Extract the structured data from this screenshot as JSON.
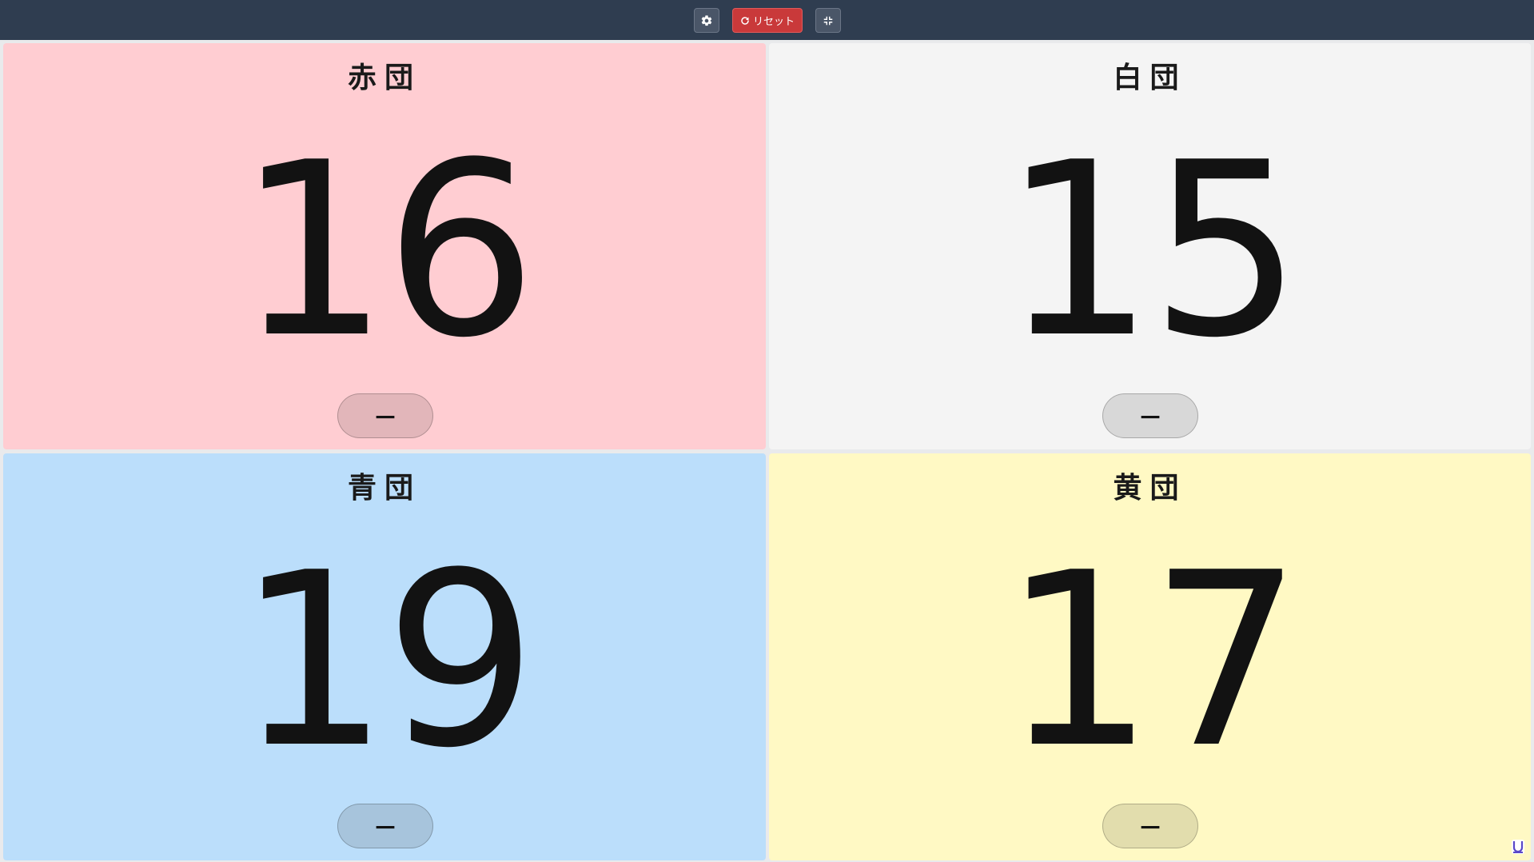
{
  "toolbar": {
    "settings_icon": "gear-icon",
    "reset_label": "リセット",
    "reset_icon": "refresh-icon",
    "fullscreen_icon": "exit-fullscreen-icon"
  },
  "teams": [
    {
      "name": "赤団",
      "score": "16",
      "minus_label": "－",
      "color": "#ffcdd2",
      "button_color": "#e2b6ba"
    },
    {
      "name": "白団",
      "score": "15",
      "minus_label": "－",
      "color": "#f4f4f4",
      "button_color": "#d8d8d8"
    },
    {
      "name": "青団",
      "score": "19",
      "minus_label": "－",
      "color": "#bbdefb",
      "button_color": "#a7c4dc"
    },
    {
      "name": "黄団",
      "score": "17",
      "minus_label": "－",
      "color": "#fff9c4",
      "button_color": "#e2ddad"
    }
  ],
  "colors": {
    "topbar": "#2f3d50",
    "reset_button": "#c9393a"
  }
}
